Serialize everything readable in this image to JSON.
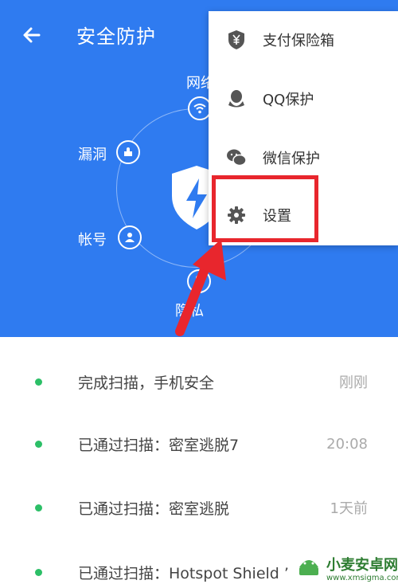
{
  "header": {
    "title": "安全防护",
    "nodes": {
      "network": "网络",
      "vulnerability": "漏洞",
      "account": "帐号",
      "privacy": "隐私"
    }
  },
  "menu": {
    "items": [
      {
        "label": "支付保险箱",
        "icon": "yen-shield-icon"
      },
      {
        "label": "QQ保护",
        "icon": "qq-penguin-icon"
      },
      {
        "label": "微信保护",
        "icon": "wechat-icon"
      },
      {
        "label": "设置",
        "icon": "gear-icon"
      }
    ]
  },
  "scan_log": [
    {
      "text": "完成扫描，手机安全",
      "time": "刚刚"
    },
    {
      "text": "已通过扫描：密室逃脱7",
      "time": "20:08"
    },
    {
      "text": "已通过扫描：密室逃脱",
      "time": "1天前"
    },
    {
      "text": "已通过扫描：Hotspot Shield ’",
      "time": ""
    }
  ],
  "watermark": {
    "name": "小麦安卓网",
    "url": "www.xmsigma.com"
  },
  "colors": {
    "header_bg": "#2f7bf0",
    "status_dot": "#2cbf67",
    "highlight": "#e8262d"
  }
}
